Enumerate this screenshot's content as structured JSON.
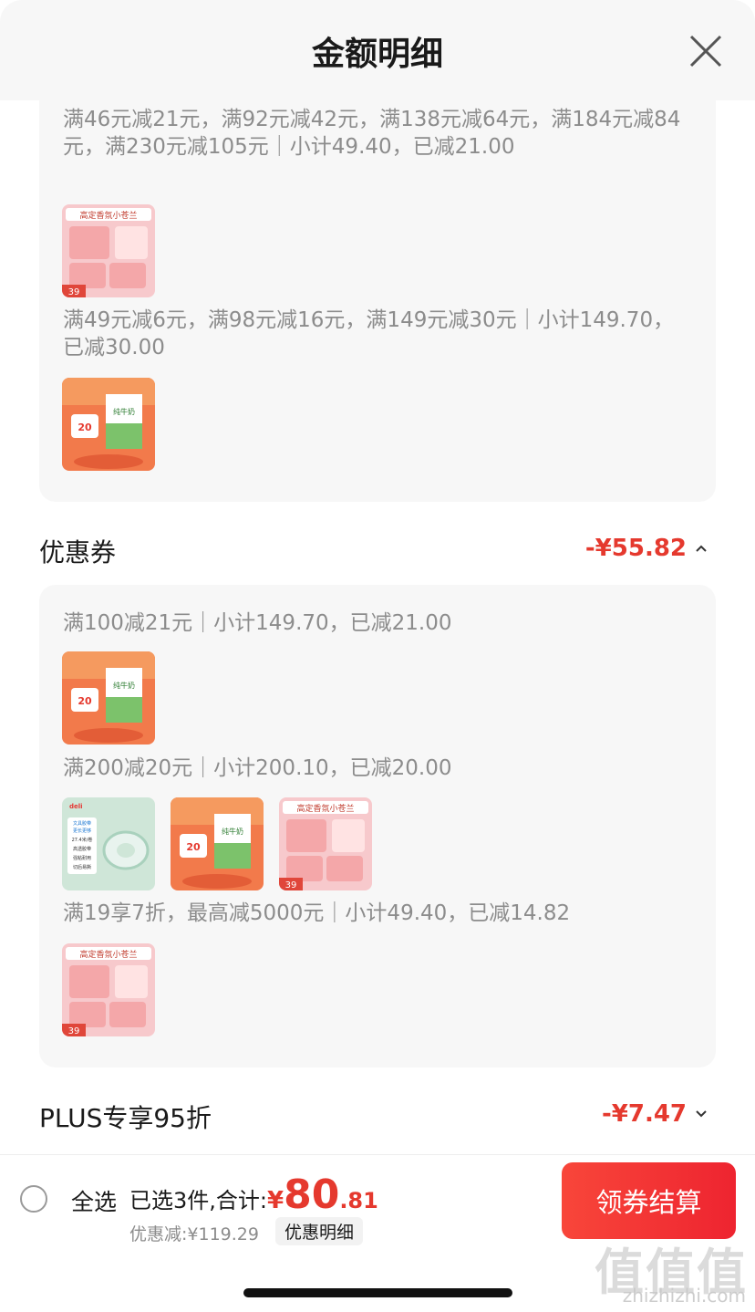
{
  "header": {
    "title": "金额明细"
  },
  "promo_card": {
    "rule1": "满46元减21元，满92元减42元，满138元减64元，满184元减84元，满230元减105元｜小计49.40，已减21.00",
    "rule2": "满49元减6元，满98元减16元，满149元减30元｜小计149.70，已减30.00"
  },
  "coupon_section": {
    "label": "优惠券",
    "amount": "-¥55.82",
    "rules": [
      "满100减21元｜小计149.70，已减21.00",
      "满200减20元｜小计200.10，已减20.00",
      "满19享7折，最高减5000元｜小计49.40，已减14.82"
    ]
  },
  "plus_section": {
    "label": "PLUS专享95折",
    "amount": "-¥7.47"
  },
  "products": {
    "snack_title": "高定香氛小苍兰",
    "snack_badge": "39",
    "milk_brand": "纯牛奶",
    "milk_badge": "20",
    "tape_brand": "deli",
    "tape_lines": [
      "文具胶带",
      "更长更够",
      "27.4米/卷",
      "高透胶带",
      "强粘耐用",
      "切后易撕"
    ]
  },
  "bottom_bar": {
    "select_all": "全选",
    "selected_prefix": "已选3件,合计:",
    "currency": "¥",
    "total_int": "80",
    "total_dec": ".81",
    "discount_text": "优惠减:¥119.29",
    "detail_btn": "优惠明细",
    "checkout_btn": "领券结算"
  },
  "watermark": {
    "big": "值值值",
    "small": "zhizhizhi.com"
  },
  "colors": {
    "accent": "#e5392e",
    "card_bg": "#f7f7f7",
    "muted_text": "#8c8c8c"
  }
}
